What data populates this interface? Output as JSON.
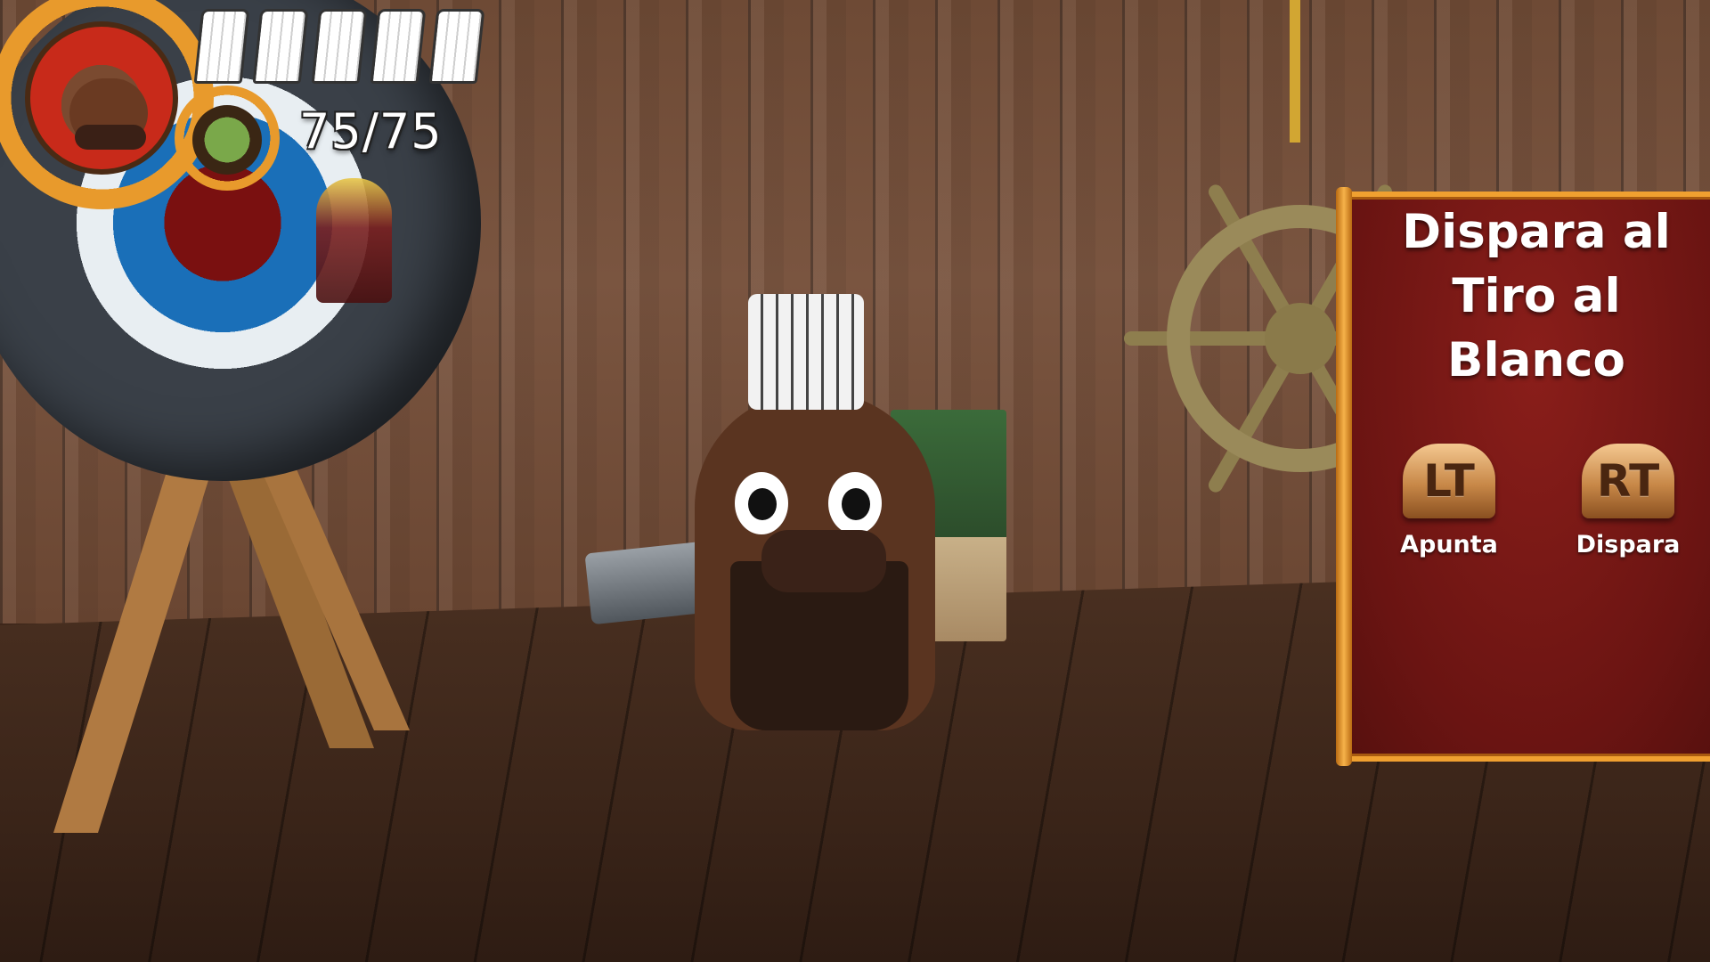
{
  "hud": {
    "health_text": "75/75",
    "chef_hat_count": 5,
    "portrait_icon": "platypus-chef-portrait",
    "secondary_icon": "leaf-shield-icon"
  },
  "instructions": {
    "title_line1": "Dispara al",
    "title_line2": "Tiro al Blanco",
    "controls": [
      {
        "button": "LT",
        "action": "Apunta"
      },
      {
        "button": "RT",
        "action": "Dispara"
      }
    ]
  },
  "colors": {
    "panel_bg": "#6a1412",
    "panel_border": "#f0a030",
    "gear": "#e89a2c",
    "trigger": "#c88848"
  }
}
